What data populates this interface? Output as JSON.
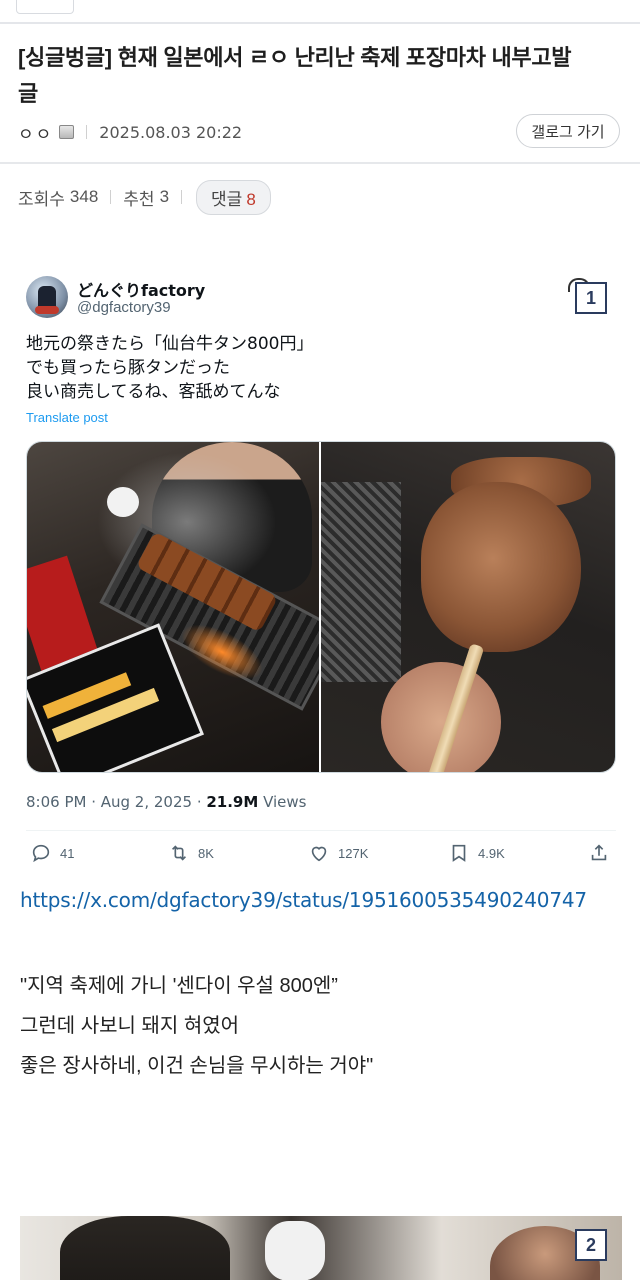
{
  "header": {
    "title": "[싱글벙글] 현재 일본에서 ㄹㅇ 난리난 축제 포장마차 내부고발글",
    "title_line1": "[싱글벙글] 현재 일본에서 ㄹㅇ 난리난 축제 포장마차 내부고발",
    "title_line2": "글",
    "author": "ㅇㅇ",
    "datetime": "2025.08.03 20:22",
    "gallery_button": "갤로그 가기"
  },
  "stats": {
    "views_label": "조회수",
    "views": "348",
    "recommend_label": "추천",
    "recommend": "3",
    "comments_label": "댓글",
    "comments": "8"
  },
  "tweet": {
    "name": "どんぐりfactory",
    "handle": "@dgfactory39",
    "badge": "1",
    "text_lines": [
      "地元の祭きたら「仙台牛タン800円」",
      "でも買ったら豚タンだった",
      "良い商売してるね、客舐めてんな"
    ],
    "translate": "Translate post",
    "time": "8:06 PM · Aug 2, 2025 · ",
    "views_count": "21.9M",
    "views_word": " Views",
    "replies": "41",
    "retweets": "8K",
    "likes": "127K",
    "bookmarks": "4.9K",
    "icons": [
      "reply-icon",
      "retweet-icon",
      "like-icon",
      "bookmark-icon",
      "share-icon"
    ]
  },
  "link": "https://x.com/dgfactory39/status/1951600535490240747",
  "body": {
    "lines": [
      "\"지역 축제에 가니 '센다이 우설 800엔”",
      "그런데 사보니 돼지 혀였어",
      "좋은 장사하네, 이건 손님을 무시하는 거야\""
    ]
  },
  "second_image": {
    "badge": "2"
  },
  "colors": {
    "link": "#1463a8",
    "comment_count": "#c0392b",
    "badge_border": "#2a3b5e",
    "tweet_blue": "#1d9bf0"
  }
}
